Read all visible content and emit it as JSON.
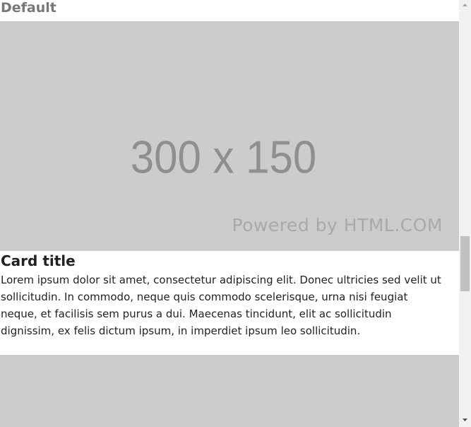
{
  "page": {
    "heading": "Default"
  },
  "card": {
    "image": {
      "dimensions_text": "300 x 150",
      "watermark_text": "Powered by HTML.COM"
    },
    "title": "Card title",
    "text": "Lorem ipsum dolor sit amet, consectetur adipiscing elit. Donec ultricies sed velit ut sollicitudin. In commodo, neque quis commodo scelerisque, urna nisi feugiat neque, et facilisis sem purus a dui. Maecenas tincidunt, elit ac sollicitudin dignissim, ex felis dictum ipsum, in imperdiet ipsum leo sollicitudin."
  },
  "colors": {
    "placeholder_background": "#cccccc",
    "placeholder_text": "#8f8f8f",
    "watermark": "#a9a9a9",
    "heading": "#777777",
    "body_text": "#222222",
    "scrollbar_track": "#f1f1f1",
    "scrollbar_thumb": "#c1c1c1"
  },
  "icons": {
    "scroll_up": "triangle-up-icon",
    "scroll_down": "triangle-down-icon"
  }
}
